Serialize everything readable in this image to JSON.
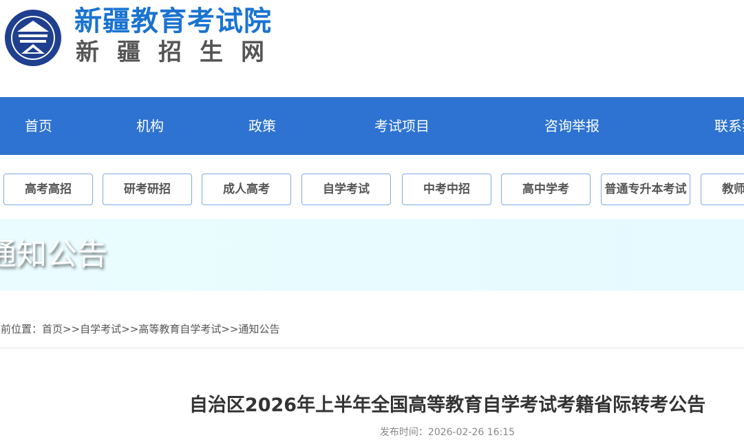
{
  "header": {
    "title": "新疆教育考试院",
    "subtitle": "新疆招生网",
    "logo_text": "新疆教育考试院"
  },
  "main_nav": {
    "items": [
      {
        "label": "首页"
      },
      {
        "label": "机构"
      },
      {
        "label": "政策"
      },
      {
        "label": "考试项目"
      },
      {
        "label": "咨询举报"
      },
      {
        "label": "联系我们"
      }
    ]
  },
  "sub_nav": {
    "items": [
      {
        "label": "高考高招"
      },
      {
        "label": "研考研招"
      },
      {
        "label": "成人高考"
      },
      {
        "label": "自学考试"
      },
      {
        "label": "中考中招"
      },
      {
        "label": "高中学考"
      },
      {
        "label": "普通专升本考试"
      },
      {
        "label": "教师资格"
      }
    ]
  },
  "banner": {
    "title": "通知公告"
  },
  "breadcrumb": {
    "prefix": "当前位置：",
    "items": [
      "首页",
      "自学考试",
      "高等教育自学考试",
      "通知公告"
    ],
    "separator": ">>"
  },
  "article": {
    "title": "自治区2026年上半年全国高等教育自学考试考籍省际转考公告",
    "published_label": "发布时间：",
    "published_at": "2026-02-26 16:15"
  },
  "colors": {
    "brand_blue": "#2e73d1",
    "title_blue": "#1a73d1",
    "subnav_border": "#7fa9e3"
  }
}
